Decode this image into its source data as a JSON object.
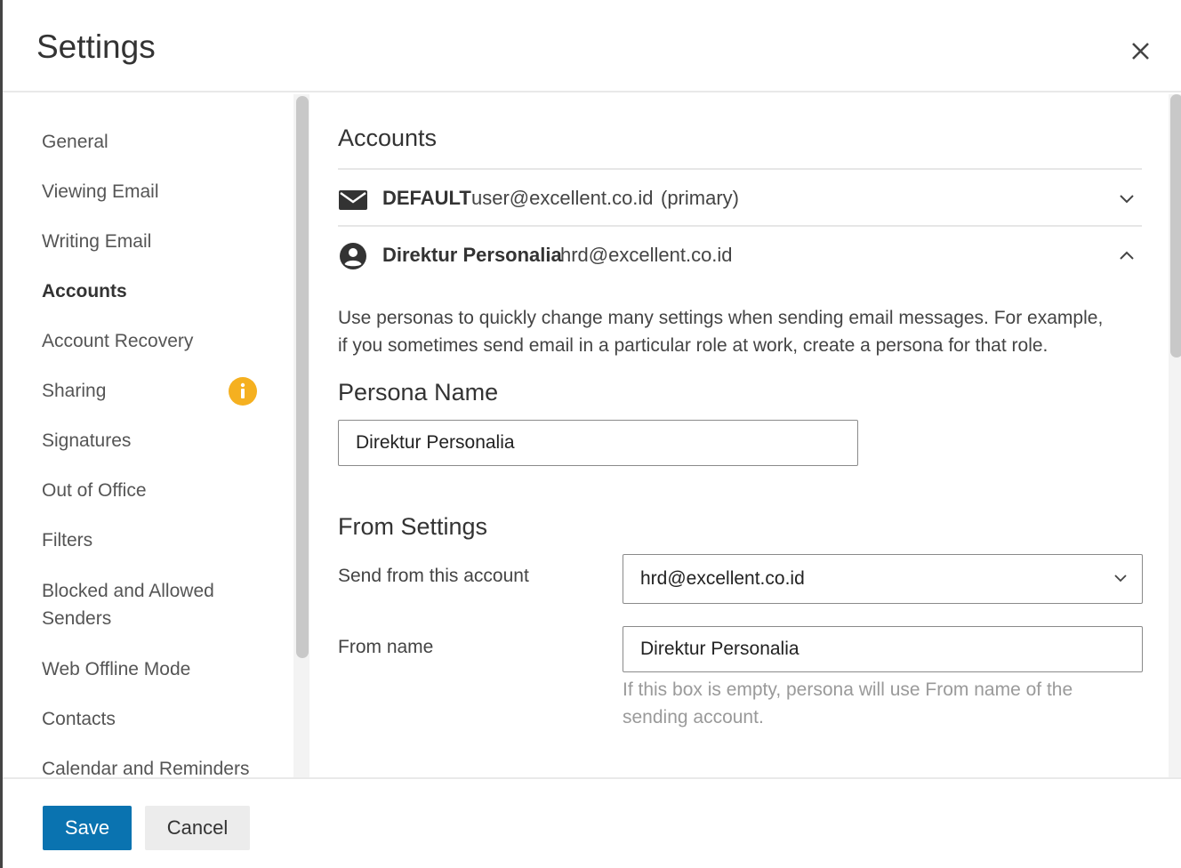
{
  "dialog": {
    "title": "Settings"
  },
  "sidebar": {
    "items": [
      {
        "label": "General"
      },
      {
        "label": "Viewing Email"
      },
      {
        "label": "Writing Email"
      },
      {
        "label": "Accounts",
        "active": true
      },
      {
        "label": "Account Recovery"
      },
      {
        "label": "Sharing",
        "badge": "info-icon"
      },
      {
        "label": "Signatures"
      },
      {
        "label": "Out of Office"
      },
      {
        "label": "Filters"
      },
      {
        "label": "Blocked and Allowed"
      },
      {
        "label": "Senders"
      },
      {
        "label": "Web Offline Mode"
      },
      {
        "label": "Contacts"
      },
      {
        "label": "Calendar and Reminders"
      }
    ]
  },
  "main": {
    "heading": "Accounts",
    "accounts": [
      {
        "icon": "envelope-icon",
        "name": "DEFAULT",
        "email": "user@excellent.co.id",
        "tag": "(primary)",
        "expanded": false
      },
      {
        "icon": "person-circle-icon",
        "name": "Direktur Personalia",
        "email": "hrd@excellent.co.id",
        "expanded": true
      }
    ],
    "description_line1": "Use personas to quickly change many settings when sending email messages. For example,",
    "description_line2": "if you sometimes send email in a particular role at work, create a persona for that role.",
    "persona_name_heading": "Persona Name",
    "persona_name_value": "Direktur Personalia",
    "from_settings_heading": "From Settings",
    "send_from_label": "Send from this account",
    "send_from_value": "hrd@excellent.co.id",
    "from_name_label": "From name",
    "from_name_value": "Direktur Personalia",
    "from_name_hint_line1": "If this box is empty, persona will use From name of the",
    "from_name_hint_line2": "sending account."
  },
  "footer": {
    "save_label": "Save",
    "cancel_label": "Cancel"
  },
  "colors": {
    "primary": "#0a73b0",
    "badge": "#f5b020",
    "border": "#8a8a8a"
  }
}
